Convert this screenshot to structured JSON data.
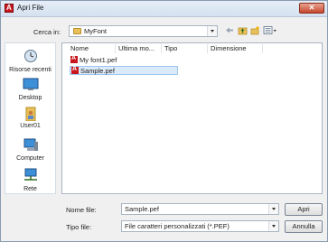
{
  "window": {
    "title": "Apri File",
    "close_label": "✕"
  },
  "lookin": {
    "label": "Cerca in:",
    "folder": "MyFont"
  },
  "toolbar": {
    "back_icon": "back-arrow-icon",
    "up_icon": "up-folder-icon",
    "newfolder_icon": "new-folder-icon",
    "view_icon": "view-menu-icon"
  },
  "places": [
    {
      "label": "Risorse recenti",
      "icon": "recent-icon"
    },
    {
      "label": "Desktop",
      "icon": "desktop-icon"
    },
    {
      "label": "User01",
      "icon": "user-folder-icon"
    },
    {
      "label": "Computer",
      "icon": "computer-icon"
    },
    {
      "label": "Rete",
      "icon": "network-icon"
    }
  ],
  "filelist": {
    "columns": [
      "Nome",
      "Ultima mo...",
      "Tipo",
      "Dimensione"
    ],
    "files": [
      {
        "name": "My font1.pef",
        "selected": false
      },
      {
        "name": "Sample.pef",
        "selected": true
      }
    ]
  },
  "filename": {
    "label": "Nome file:",
    "value": "Sample.pef"
  },
  "filetype": {
    "label": "Tipo file:",
    "value": "File caratteri personalizzati (*.PEF)"
  },
  "buttons": {
    "open": "Apri",
    "cancel": "Annulla"
  },
  "colors": {
    "accent": "#c8161d",
    "selection": "#dbeaf9"
  }
}
